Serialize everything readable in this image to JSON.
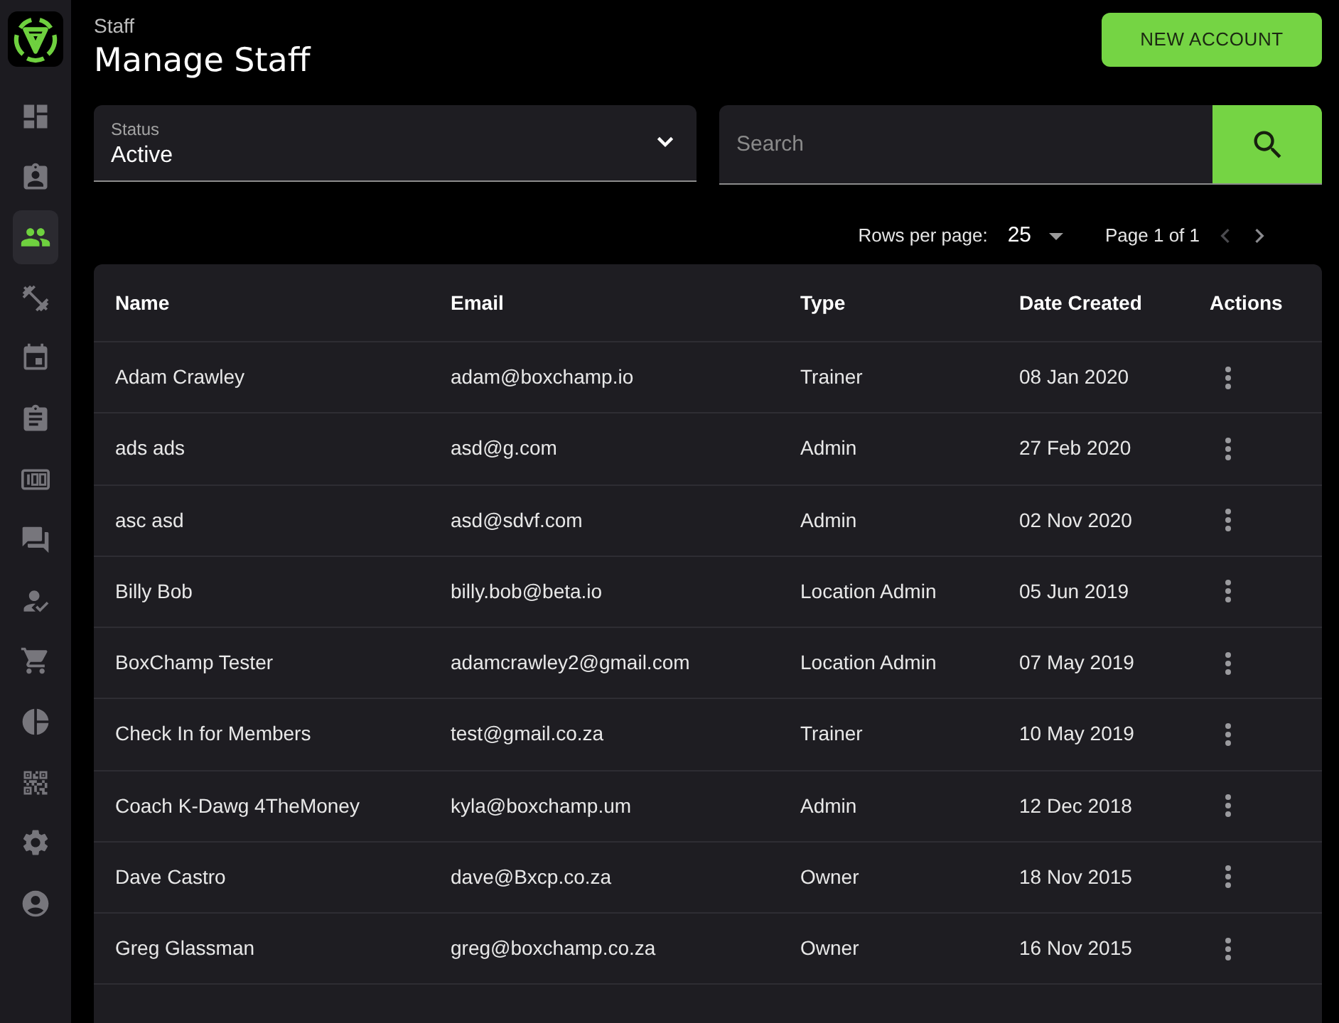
{
  "sidebar": {
    "items": [
      {
        "selected": false
      },
      {
        "selected": false
      },
      {
        "selected": true
      },
      {
        "selected": false
      },
      {
        "selected": false
      },
      {
        "selected": false
      },
      {
        "selected": false
      },
      {
        "selected": false
      },
      {
        "selected": false
      },
      {
        "selected": false
      },
      {
        "selected": false
      },
      {
        "selected": false
      },
      {
        "selected": false
      },
      {
        "selected": false
      }
    ]
  },
  "header": {
    "breadcrumb": "Staff",
    "title": "Manage Staff",
    "new_account_button": "NEW ACCOUNT"
  },
  "filters": {
    "status": {
      "label": "Status",
      "value": "Active"
    },
    "search": {
      "placeholder": "Search"
    }
  },
  "pagination": {
    "rows_per_page_label": "Rows per page:",
    "rows_per_page": "25",
    "page_info": "Page 1 of 1",
    "previous": {
      "disabled": true
    },
    "next": {
      "disabled": false
    }
  },
  "table": {
    "columns": [
      "Name",
      "Email",
      "Type",
      "Date Created",
      "Actions"
    ],
    "rows": [
      {
        "name": "Adam Crawley",
        "email": "adam@boxchamp.io",
        "type": "Trainer",
        "date_created": "08 Jan 2020"
      },
      {
        "name": "ads ads",
        "email": "asd@g.com",
        "type": "Admin",
        "date_created": "27 Feb 2020"
      },
      {
        "name": "asc asd",
        "email": "asd@sdvf.com",
        "type": "Admin",
        "date_created": "02 Nov 2020"
      },
      {
        "name": "Billy Bob",
        "email": "billy.bob@beta.io",
        "type": "Location Admin",
        "date_created": "05 Jun 2019"
      },
      {
        "name": "BoxChamp Tester",
        "email": "adamcrawley2@gmail.com",
        "type": "Location Admin",
        "date_created": "07 May 2019"
      },
      {
        "name": "Check In for Members",
        "email": "test@gmail.co.za",
        "type": "Trainer",
        "date_created": "10 May 2019"
      },
      {
        "name": "Coach K-Dawg 4TheMoney",
        "email": "kyla@boxchamp.um",
        "type": "Admin",
        "date_created": "12 Dec 2018"
      },
      {
        "name": "Dave Castro",
        "email": "dave@Bxcp.co.za",
        "type": "Owner",
        "date_created": "18 Nov 2015"
      },
      {
        "name": "Greg Glassman",
        "email": "greg@boxchamp.co.za",
        "type": "Owner",
        "date_created": "16 Nov 2015"
      }
    ]
  }
}
